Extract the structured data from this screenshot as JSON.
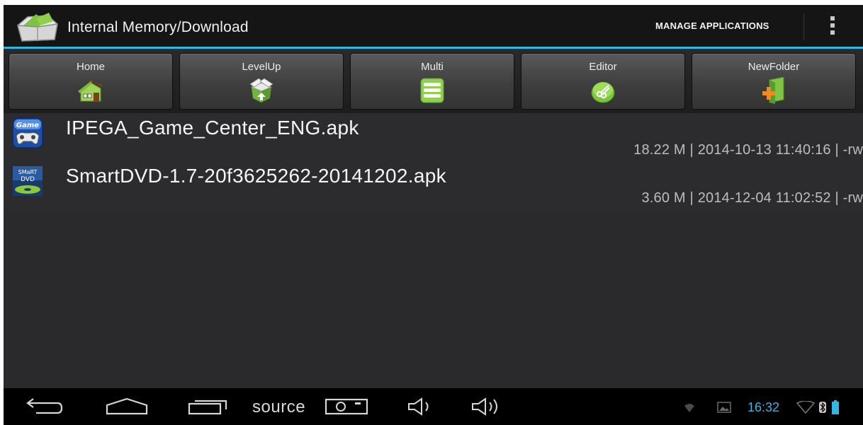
{
  "action_bar": {
    "title": "Internal Memory/Download",
    "manage_label": "MANAGE APPLICATIONS",
    "app_icon": "file-manager-icon",
    "overflow_icon": "overflow-menu-icon"
  },
  "toolbar": {
    "buttons": [
      {
        "label": "Home",
        "icon": "home-icon"
      },
      {
        "label": "LevelUp",
        "icon": "level-up-icon"
      },
      {
        "label": "Multi",
        "icon": "multi-select-icon"
      },
      {
        "label": "Editor",
        "icon": "editor-icon"
      },
      {
        "label": "NewFolder",
        "icon": "new-folder-icon"
      }
    ]
  },
  "files": [
    {
      "name": "IPEGA_Game_Center_ENG.apk",
      "meta": "18.22 M | 2014-10-13 11:40:16 | -rw",
      "icon": "game-center-icon"
    },
    {
      "name": "SmartDVD-1.7-20f3625262-20141202.apk",
      "meta": "3.60 M | 2014-12-04 11:02:52 | -rw",
      "icon": "smart-dvd-icon"
    }
  ],
  "nav_bar": {
    "back_icon": "back-icon",
    "home_icon": "home-nav-icon",
    "recents_icon": "recents-icon",
    "source_label": "source",
    "screenshot_icon": "screenshot-icon",
    "volume_down_icon": "volume-down-icon",
    "volume_up_icon": "volume-up-icon"
  },
  "status": {
    "time": "16:32",
    "icons": [
      "wifi-icon",
      "gallery-icon",
      "signal-icon",
      "bluetooth-icon",
      "battery-icon"
    ]
  },
  "colors": {
    "accent": "#33b5e5",
    "background": "#2c2c2e",
    "action_bar": "#151515"
  }
}
